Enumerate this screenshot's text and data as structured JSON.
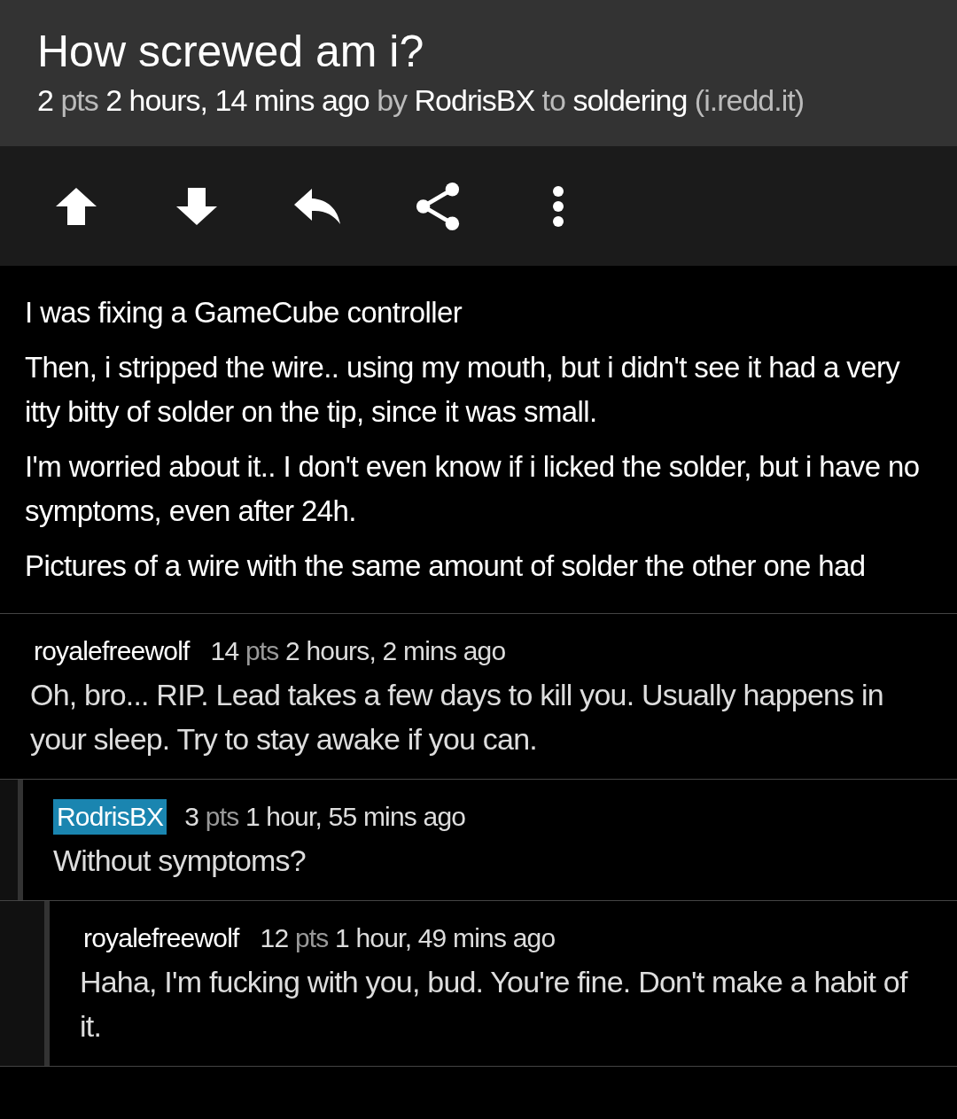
{
  "post": {
    "title": "How screwed am i?",
    "meta": [
      {
        "text": "2",
        "strong": true
      },
      {
        "text": "pts",
        "strong": false
      },
      {
        "text": "2 hours, 14 mins ago",
        "strong": true
      },
      {
        "text": "by",
        "strong": false
      },
      {
        "text": "RodrisBX",
        "strong": true
      },
      {
        "text": "to",
        "strong": false
      },
      {
        "text": "soldering",
        "strong": true
      },
      {
        "text": "(i.redd.it)",
        "strong": false
      }
    ]
  },
  "toolbar": [
    {
      "kind": "upvote"
    },
    {
      "kind": "downvote"
    },
    {
      "kind": "reply"
    },
    {
      "kind": "share"
    },
    {
      "kind": "more"
    }
  ],
  "body": [
    "I was fixing a GameCube controller",
    "Then, i stripped the wire.. using my mouth, but i didn't see it had a very itty bitty of solder on the tip, since it was small.",
    "I'm worried about it.. I don't even know if i licked the solder, but i have no symptoms, even after 24h.",
    "Pictures of a wire with the same amount of solder the other one had"
  ],
  "comments": [
    {
      "author": "royalefreewolf",
      "op": false,
      "score": "14",
      "unit": "pts",
      "time": "2 hours, 2 mins ago",
      "text": "Oh, bro... RIP. Lead takes a few days to kill you. Usually happens in your sleep. Try to stay awake if you can.",
      "children": [
        {
          "author": "RodrisBX",
          "op": true,
          "score": "3",
          "unit": "pts",
          "time": "1 hour, 55 mins ago",
          "text": "Without symptoms?",
          "children": [
            {
              "author": "royalefreewolf",
              "op": false,
              "score": "12",
              "unit": "pts",
              "time": "1 hour, 49 mins ago",
              "text": "Haha, I'm fucking with you, bud. You're fine. Don't make a habit of it."
            }
          ]
        }
      ]
    }
  ]
}
